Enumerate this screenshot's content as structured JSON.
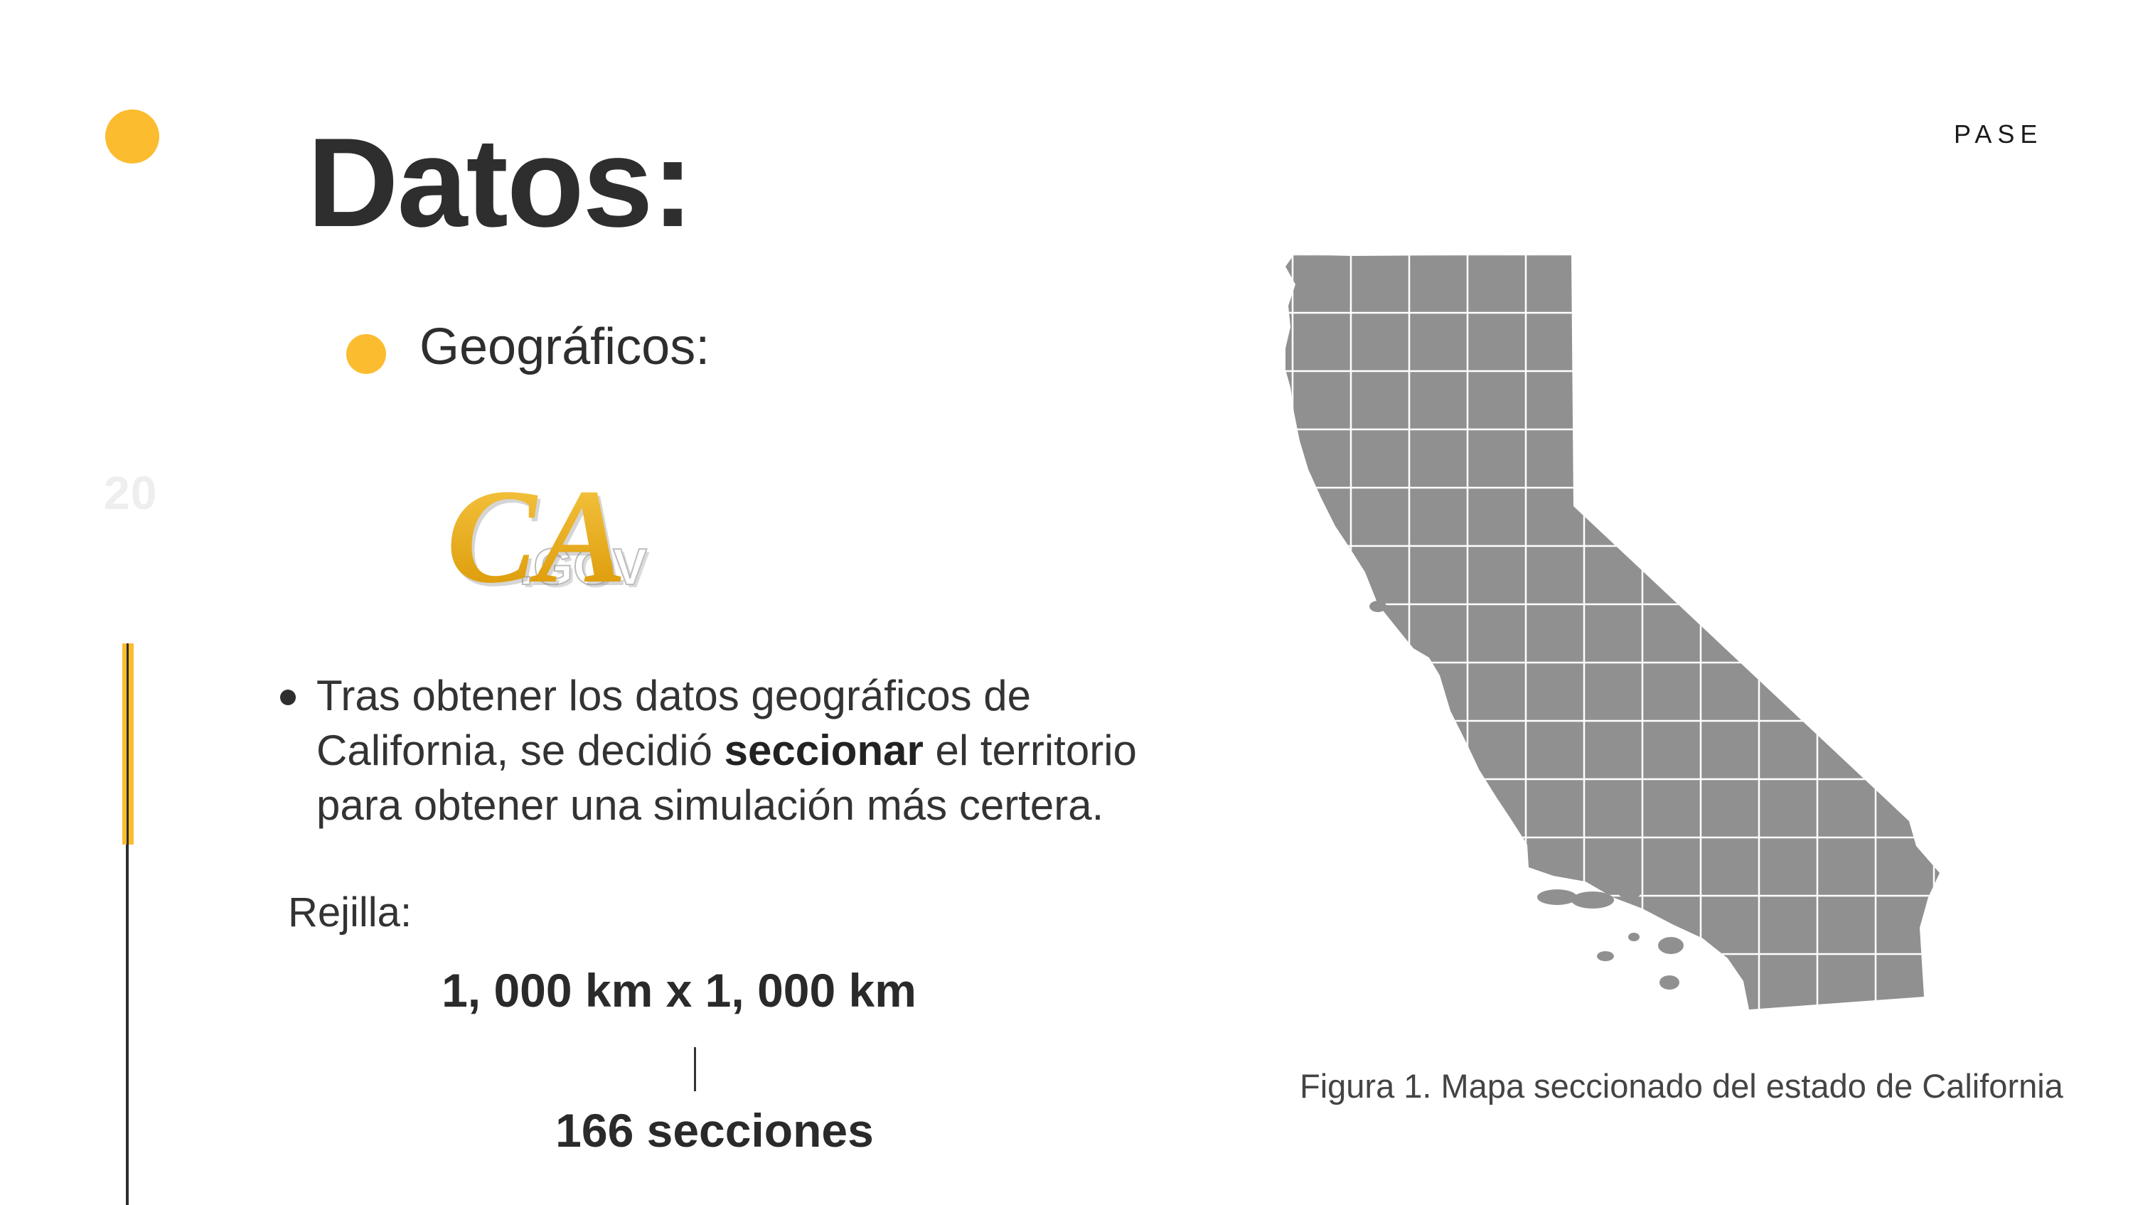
{
  "slide": {
    "brand": "PASE",
    "page_number": "20",
    "title": "Datos:",
    "section_heading": "Geográficos:",
    "logo": {
      "main_text": "CA",
      "sub_text": ".GOV",
      "icon": "ca-gov-logo"
    },
    "paragraph": {
      "before": "Tras obtener los datos geográficos de California, se decidió ",
      "bold": "seccionar",
      "after": " el territorio para obtener una simulación más certera."
    },
    "grid": {
      "label": "Rejilla:",
      "size": "1, 000 km x 1, 000 km",
      "sections": "166 secciones"
    },
    "figure_caption": "Figura 1. Mapa seccionado del estado de California"
  },
  "colors": {
    "accent": "#fbbc30",
    "text": "#2e2e2e",
    "map_fill": "#909090",
    "grid_lines": "#ffffff"
  }
}
